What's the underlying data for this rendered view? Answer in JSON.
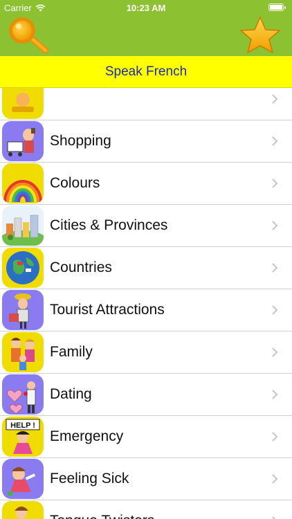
{
  "status_bar": {
    "carrier": "Carrier",
    "time": "10:23 AM"
  },
  "nav": {
    "title": "Speak French",
    "search_icon": "magnifying-glass-icon",
    "favorite_icon": "star-icon"
  },
  "colors": {
    "nav_green": "#8cc232",
    "title_yellow": "#ffff00",
    "title_text": "#1c2ca8",
    "thumb_purple": "#8a7cf0",
    "thumb_yellow": "#f0dc00"
  },
  "categories": [
    {
      "label": "",
      "thumb": "yellow"
    },
    {
      "label": "Shopping",
      "thumb": "purple"
    },
    {
      "label": "Colours",
      "thumb": "yellow"
    },
    {
      "label": "Cities & Provinces",
      "thumb": "white"
    },
    {
      "label": "Countries",
      "thumb": "yellow"
    },
    {
      "label": "Tourist Attractions",
      "thumb": "purple"
    },
    {
      "label": "Family",
      "thumb": "yellow"
    },
    {
      "label": "Dating",
      "thumb": "purple"
    },
    {
      "label": "Emergency",
      "thumb": "yellow"
    },
    {
      "label": "Feeling Sick",
      "thumb": "purple"
    },
    {
      "label": "Tongue Twisters",
      "thumb": "yellow"
    }
  ],
  "emergency_sign": "HELP !"
}
